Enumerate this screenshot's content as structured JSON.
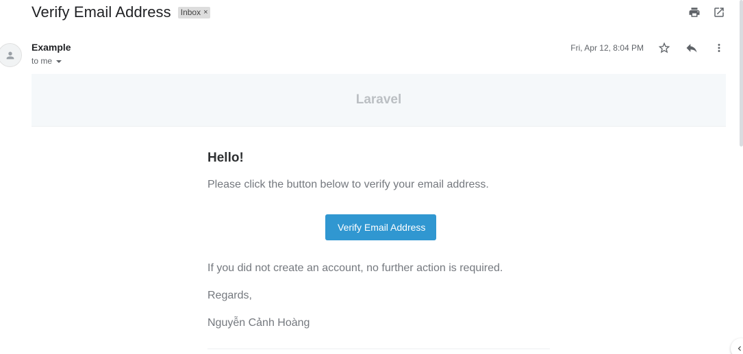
{
  "email": {
    "subject": "Verify Email Address",
    "label": "Inbox",
    "label_remove_glyph": "×",
    "sender_name": "Example",
    "recipient": "to me",
    "date": "Fri, Apr 12, 8:04 PM"
  },
  "toolbar_icons": [
    "print-icon",
    "open-in-new-window-icon",
    "star-icon",
    "reply-icon",
    "more-vert-icon"
  ],
  "body": {
    "brand": "Laravel",
    "greeting": "Hello!",
    "intro": "Please click the button below to verify your email address.",
    "action_label": "Verify Email Address",
    "outro": "If you did not create an account, no further action is required.",
    "regards": "Regards,",
    "signature": "Nguyễn Cảnh Hoàng"
  },
  "colors": {
    "button": "#3097d1",
    "header_bg": "#f5f8fa",
    "brand_text": "#bbbfc3",
    "body_text": "#74787e"
  }
}
